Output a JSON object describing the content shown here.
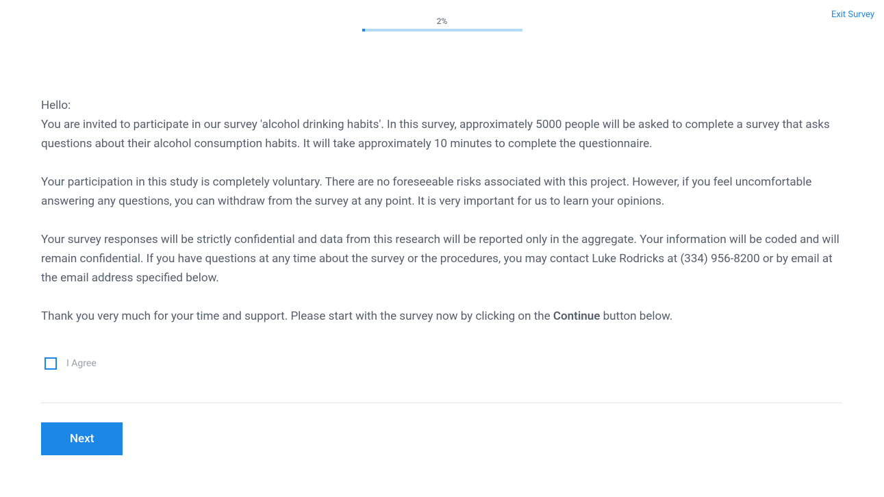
{
  "header": {
    "exit_label": "Exit Survey",
    "progress_percent_label": "2%",
    "progress_percent_value": 2
  },
  "consent": {
    "greeting": "Hello:",
    "p1": "You are invited to participate in our survey 'alcohol drinking habits'. In this survey, approximately 5000 people will be asked to complete a survey that asks questions about their alcohol consumption habits. It will take approximately 10 minutes to complete the questionnaire.",
    "p2": "Your participation in this study is completely voluntary. There are no foreseeable risks associated with this project. However, if you feel uncomfortable answering any questions, you can withdraw from the survey at any point. It is very important for us to learn your opinions.",
    "p3": "Your survey responses will be strictly confidential and data from this research will be reported only in the aggregate. Your information will be coded and will remain confidential. If you have questions at any time about the survey or the procedures, you may contact Luke Rodricks at (334) 956-8200 or by email at the email address specified below.",
    "p4_pre": "Thank you very much for your time and support. Please start with the survey now by clicking on the ",
    "p4_bold": "Continue",
    "p4_post": " button below.",
    "agree_label": "I Agree"
  },
  "footer": {
    "next_label": "Next"
  }
}
